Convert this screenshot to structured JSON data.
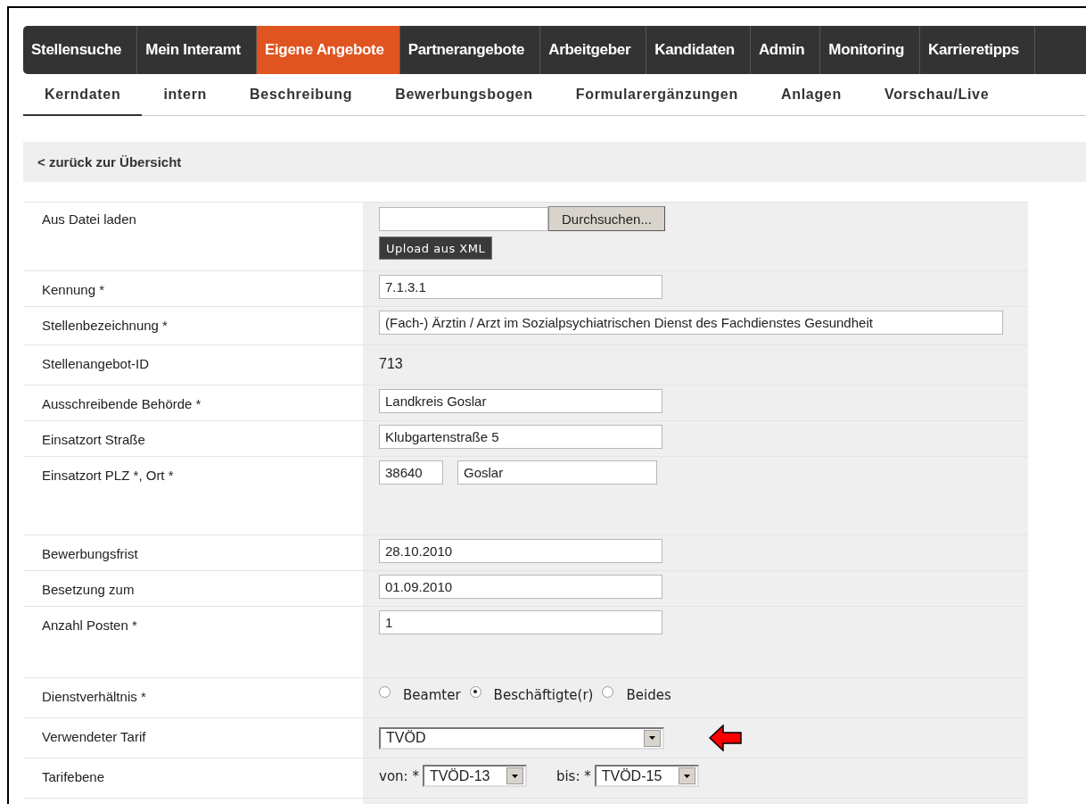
{
  "main_nav": [
    {
      "label": "Stellensuche",
      "selected": false
    },
    {
      "label": "Mein Interamt",
      "selected": false
    },
    {
      "label": "Eigene Angebote",
      "selected": true
    },
    {
      "label": "Partnerangebote",
      "selected": false
    },
    {
      "label": "Arbeitgeber",
      "selected": false
    },
    {
      "label": "Kandidaten",
      "selected": false
    },
    {
      "label": "Admin",
      "selected": false
    },
    {
      "label": "Monitoring",
      "selected": false
    },
    {
      "label": "Karrieretipps",
      "selected": false
    }
  ],
  "sub_tabs": [
    {
      "label": "Kerndaten",
      "selected": true
    },
    {
      "label": "intern",
      "selected": false
    },
    {
      "label": "Beschreibung",
      "selected": false
    },
    {
      "label": "Bewerbungsbogen",
      "selected": false
    },
    {
      "label": "Formularergänzungen",
      "selected": false
    },
    {
      "label": "Anlagen",
      "selected": false
    },
    {
      "label": "Vorschau/Live",
      "selected": false
    }
  ],
  "back_link": {
    "arrow": "<",
    "label": "zurück zur Übersicht"
  },
  "form_rows": [
    {
      "kind": "file",
      "label": "Aus Datei laden",
      "browse_button": "Durchsuchen...",
      "upload_button": "Upload aus XML"
    },
    {
      "kind": "text",
      "label": "Kennung *",
      "value": "7.1.3.1"
    },
    {
      "kind": "wide",
      "label": "Stellenbezeichnung *",
      "value": "(Fach-) Ärztin / Arzt im Sozialpsychiatrischen Dienst des Fachdienstes Gesundheit"
    },
    {
      "kind": "static",
      "label": "Stellenangebot-ID",
      "value": "713"
    },
    {
      "kind": "text",
      "label": "Ausschreibende Behörde *",
      "value": "Landkreis Goslar"
    },
    {
      "kind": "text",
      "label": "Einsatzort Straße",
      "value": "Klubgartenstraße 5"
    },
    {
      "kind": "plz",
      "label": "Einsatzort PLZ *, Ort *",
      "plz": "38640",
      "city": "Goslar"
    },
    {
      "kind": "text",
      "label": "Bewerbungsfrist",
      "value": "28.10.2010"
    },
    {
      "kind": "text",
      "label": "Besetzung zum",
      "value": "01.09.2010"
    },
    {
      "kind": "text",
      "label": "Anzahl Posten *",
      "value": "1",
      "tall": true
    },
    {
      "kind": "radio",
      "label": "Dienstverhältnis *",
      "options": [
        {
          "label": "Beamter",
          "selected": false
        },
        {
          "label": "Beschäftigte(r)",
          "selected": true
        },
        {
          "label": "Beides",
          "selected": false
        }
      ]
    },
    {
      "kind": "select",
      "label": "Verwendeter Tarif",
      "value": "TVÖD",
      "highlighted": true
    },
    {
      "kind": "range",
      "label": "Tarifebene",
      "from_label": "von: *",
      "from": "TVÖD-13",
      "to_label": "bis: *",
      "to": "TVÖD-15"
    }
  ]
}
